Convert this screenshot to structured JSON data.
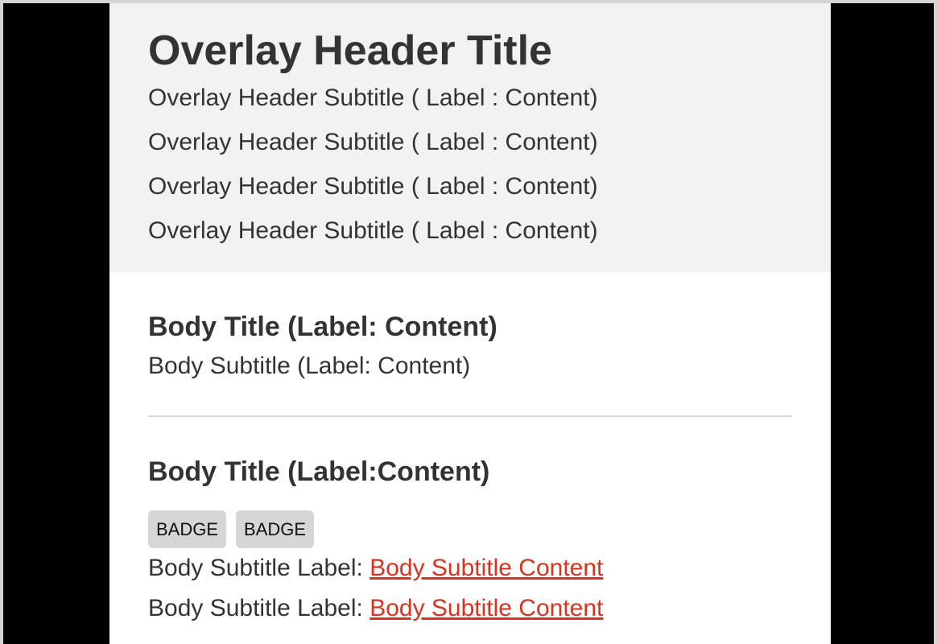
{
  "overlay": {
    "header": {
      "title": "Overlay Header Title",
      "subtitles": [
        "Overlay Header Subtitle ( Label : Content)",
        "Overlay Header Subtitle ( Label : Content)",
        "Overlay Header Subtitle ( Label : Content)",
        "Overlay Header Subtitle ( Label : Content)"
      ]
    },
    "body": {
      "section1": {
        "title": "Body Title (Label: Content)",
        "subtitle": "Body Subtitle (Label: Content)"
      },
      "section2": {
        "title": "Body Title (Label:Content)",
        "badges": [
          "BADGE",
          "BADGE"
        ],
        "rows": [
          {
            "label": "Body Subtitle Label: ",
            "content": "Body Subtitle Content"
          },
          {
            "label": "Body Subtitle Label: ",
            "content": "Body Subtitle Content"
          }
        ]
      }
    }
  },
  "colors": {
    "header_bg": "#f2f2f2",
    "backdrop": "#000000",
    "link": "#d9331f",
    "badge_bg": "#d6d6d6",
    "divider": "#d8d8d8"
  }
}
